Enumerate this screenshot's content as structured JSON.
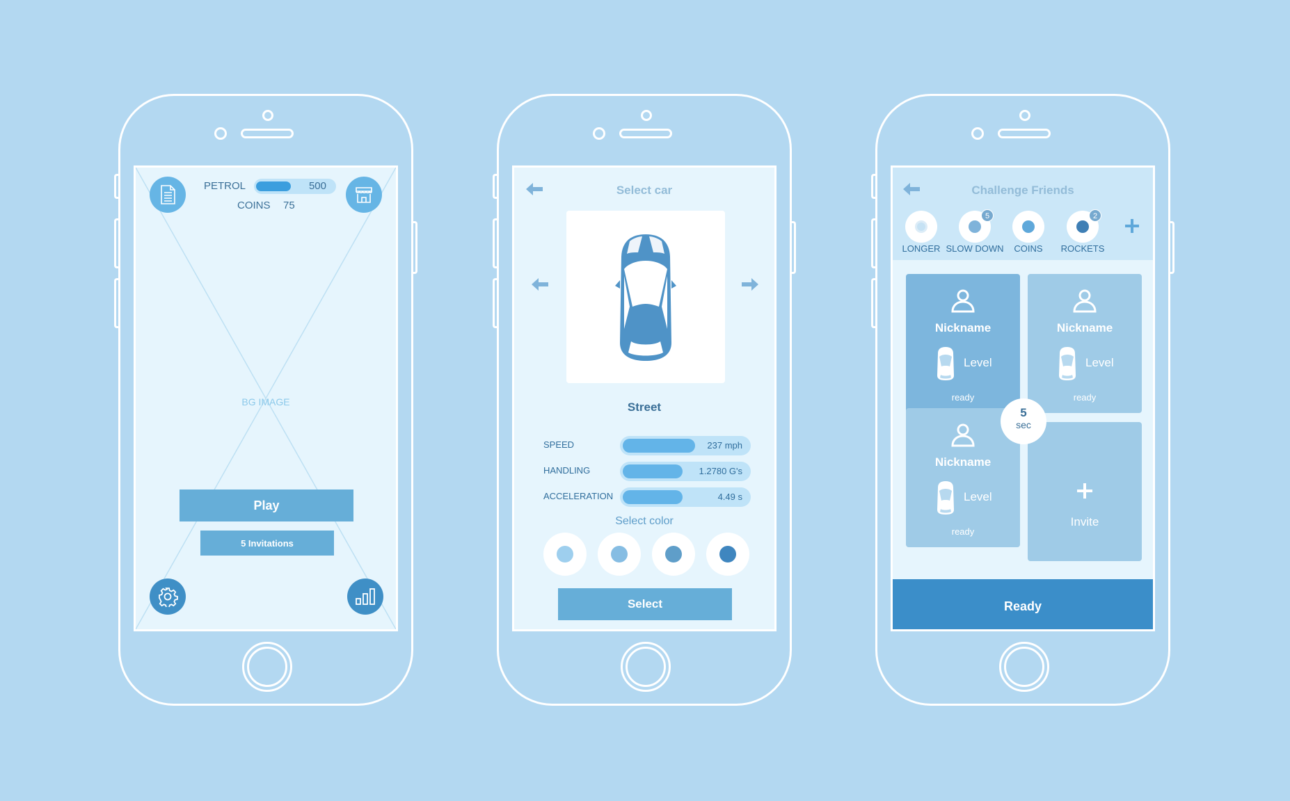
{
  "colors": {
    "background": "#b3d8f1",
    "screen": "#e6f5fd",
    "accent": "#3b9ede",
    "button": "#66aed8",
    "ready_button": "#3b8ec9"
  },
  "home": {
    "left_icon": "document-icon",
    "right_icon": "shop-icon",
    "petrol_label": "PETROL",
    "petrol_value": "500",
    "petrol_level": 0.45,
    "coins_label": "COINS",
    "coins_value": "75",
    "bg_label": "BG IMAGE",
    "play_label": "Play",
    "invitations_label": "5 Invitations",
    "settings_icon": "gear-icon",
    "stats_icon": "bar-chart-icon"
  },
  "select_car": {
    "title": "Select car",
    "car_name": "Street",
    "specs": [
      {
        "label": "SPEED",
        "value": "237 mph",
        "level": 0.58
      },
      {
        "label": "HANDLING",
        "value": "1.2780 G's",
        "level": 0.48
      },
      {
        "label": "ACCELERATION",
        "value": "4.49 s",
        "level": 0.48
      }
    ],
    "select_color_label": "Select color",
    "colors": [
      "#9ecfee",
      "#86bde3",
      "#5f9ec9",
      "#3f86bf"
    ],
    "select_label": "Select"
  },
  "challenge": {
    "title": "Challenge Friends",
    "powerups": [
      {
        "label": "LONGER",
        "badge": "",
        "color": "#c6e2f4"
      },
      {
        "label": "SLOW DOWN",
        "badge": "5",
        "color": "#7fb3da"
      },
      {
        "label": "COINS",
        "badge": "",
        "color": "#5fa8da"
      },
      {
        "label": "ROCKETS",
        "badge": "2",
        "color": "#3f7fb5"
      }
    ],
    "players": [
      {
        "nickname": "Nickname",
        "level": "Level",
        "status": "ready"
      },
      {
        "nickname": "Nickname",
        "level": "Level",
        "status": "ready"
      },
      {
        "nickname": "Nickname",
        "level": "Level",
        "status": "ready"
      }
    ],
    "invite_label": "Invite",
    "timer_value": "5",
    "timer_unit": "sec",
    "ready_label": "Ready"
  }
}
